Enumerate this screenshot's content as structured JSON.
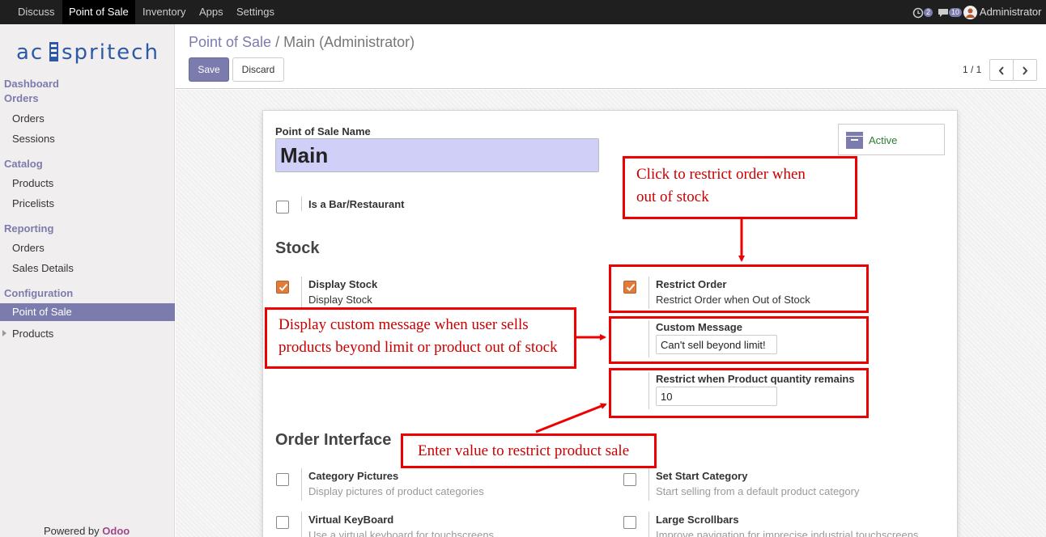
{
  "topbar": {
    "menus": [
      "Discuss",
      "Point of Sale",
      "Inventory",
      "Apps",
      "Settings"
    ],
    "active_menu": "Point of Sale",
    "activity_count": "2",
    "message_count": "10",
    "user": "Administrator"
  },
  "sidebar": {
    "logo": "acespritech",
    "sections": [
      {
        "label": "Dashboard"
      },
      {
        "label": "Orders",
        "items": [
          "Orders",
          "Sessions"
        ]
      },
      {
        "label": "Catalog",
        "items": [
          "Products",
          "Pricelists"
        ]
      },
      {
        "label": "Reporting",
        "items": [
          "Orders",
          "Sales Details"
        ]
      },
      {
        "label": "Configuration",
        "items": [
          "Point of Sale",
          "Products"
        ]
      }
    ],
    "active_item": "Point of Sale",
    "powered_by": "Powered by",
    "powered_brand": "Odoo"
  },
  "control_panel": {
    "breadcrumb_parent": "Point of Sale",
    "breadcrumb_sep": "/",
    "breadcrumb_current": "Main (Administrator)",
    "save_label": "Save",
    "discard_label": "Discard",
    "pager": "1 / 1"
  },
  "form": {
    "name_label": "Point of Sale Name",
    "name_value": "Main",
    "active_label": "Active",
    "is_bar_label": "Is a Bar/Restaurant",
    "stock_section": "Stock",
    "display_stock_label": "Display Stock",
    "display_stock_help": "Display Stock",
    "display_stock_checked": true,
    "restrict_order_label": "Restrict Order",
    "restrict_order_help": "Restrict Order when Out of Stock",
    "restrict_order_checked": true,
    "custom_message_label": "Custom Message",
    "custom_message_value": "Can't sell beyond limit!",
    "restrict_qty_label": "Restrict when Product quantity remains",
    "restrict_qty_value": "10",
    "order_interface_section": "Order Interface",
    "category_pictures_label": "Category Pictures",
    "category_pictures_help": "Display pictures of product categories",
    "set_start_category_label": "Set Start Category",
    "set_start_category_help": "Start selling from a default product category",
    "virtual_keyboard_label": "Virtual KeyBoard",
    "virtual_keyboard_help": "Use a virtual keyboard for touchscreens",
    "large_scrollbars_label": "Large Scrollbars",
    "large_scrollbars_help": "Improve navigation for imprecise industrial touchscreens"
  },
  "annotations": {
    "restrict_note_line1": "Click to restrict order when",
    "restrict_note_line2": "out of stock",
    "message_note_line1": "Display custom message when user sells",
    "message_note_line2": "products beyond limit or product out of stock",
    "qty_note": "Enter value to restrict product sale",
    "color": "#ee0000"
  }
}
